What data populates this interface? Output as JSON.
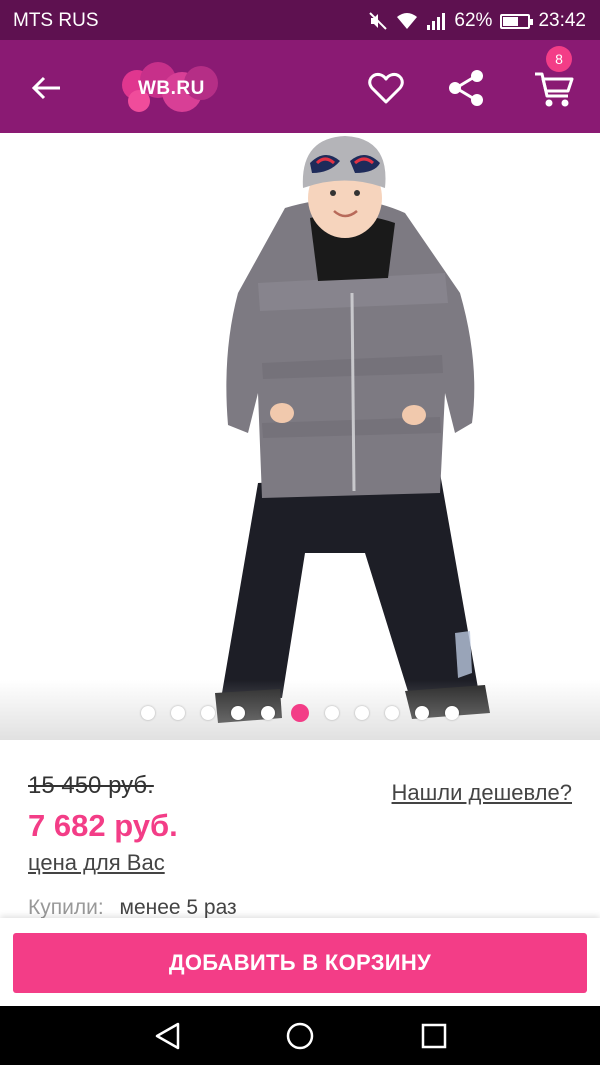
{
  "status_bar": {
    "carrier": "MTS RUS",
    "battery_percent": "62%",
    "battery_level": 0.62,
    "time": "23:42"
  },
  "app_bar": {
    "logo_text": "WB.RU",
    "cart_count": "8",
    "icons": [
      "back-arrow-icon",
      "heart-icon",
      "share-icon",
      "cart-icon"
    ]
  },
  "gallery": {
    "dot_count": 11,
    "active_index": 5
  },
  "product": {
    "old_price": "15 450 руб.",
    "new_price": "7 682 руб.",
    "your_price_label": "цена для Вас",
    "cheaper_link": "Нашли дешевле?",
    "bought_label": "Купили:",
    "bought_value": "менее 5 раз"
  },
  "actions": {
    "add_to_cart": "ДОБАВИТЬ В КОРЗИНУ"
  },
  "colors": {
    "status_bar": "#5e1150",
    "app_bar": "#8a1a73",
    "accent": "#f33d87"
  }
}
